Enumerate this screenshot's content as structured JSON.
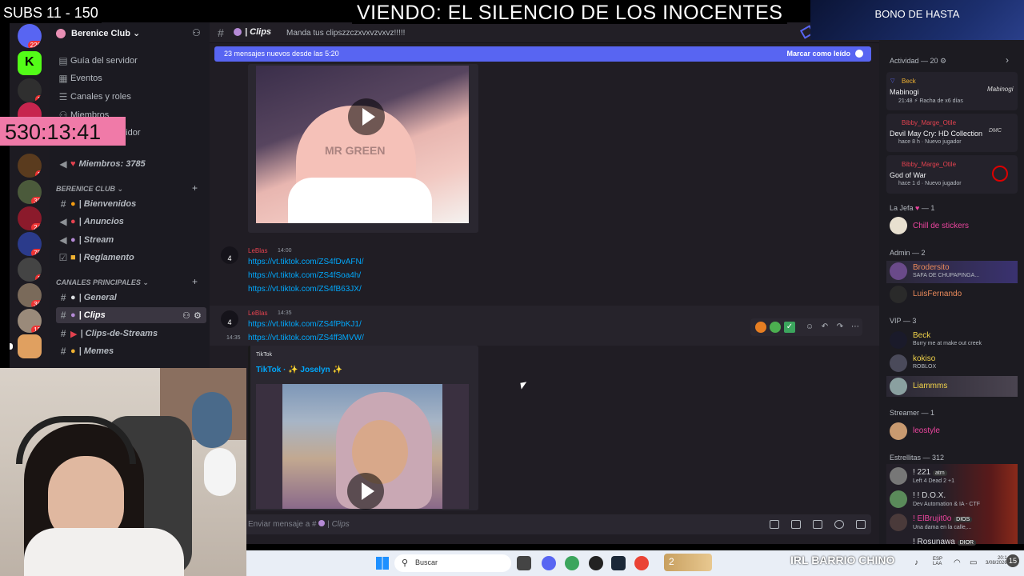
{
  "overlay": {
    "subs": "SUBS 11 - 150",
    "now_viewing": "VIENDO:  EL SILENCIO DE LOS INOCENTES",
    "bonus": "BONO DE HASTA",
    "timer": "530:13:41",
    "irl": "IRL BARRIO CHINO"
  },
  "rail": {
    "badges": [
      "226",
      "1",
      "1",
      "1",
      "38",
      "24",
      "75",
      "1",
      "36",
      "12"
    ]
  },
  "server": {
    "name": "Berenice Club",
    "top_items": [
      {
        "label": "Guía del servidor",
        "icon": "guide-icon"
      },
      {
        "label": "Eventos",
        "icon": "calendar-icon"
      },
      {
        "label": "Canales y roles",
        "icon": "list-icon"
      },
      {
        "label": "Miembros",
        "icon": "members-icon"
      },
      {
        "label": "rvidor",
        "icon": "server-icon"
      }
    ],
    "members_channel": "Miembros: 3785",
    "categories": [
      {
        "name": "BERENICE CLUB",
        "channels": [
          "Bienvenidos",
          "Anuncios",
          "Stream",
          "Reglamento"
        ]
      },
      {
        "name": "CANALES PRINCIPALES",
        "channels": [
          "General",
          "Clips",
          "Clips-de-Streams",
          "Memes"
        ]
      }
    ]
  },
  "channel": {
    "name": "Clips",
    "topic": "Manda tus clipszzczxvxvzvxvz!!!!!",
    "new_messages": "23 mensajes nuevos desde las 5:20",
    "mark_read": "Marcar como leído",
    "composer_placeholder": "Enviar mensaje a #",
    "composer_channel": "Clips"
  },
  "messages": [
    {
      "avatar_badge": "4",
      "author": "LeBlas",
      "time": "14:00",
      "links": [
        "https://vt.tiktok.com/ZS4fDvAFN/",
        "https://vt.tiktok.com/ZS4fSoa4h/",
        "https://vt.tiktok.com/ZS4fB63JX/"
      ]
    },
    {
      "avatar_badge": "4",
      "author": "LeBlas",
      "time": "14:35",
      "side_time": "14:35",
      "links": [
        "https://vt.tiktok.com/ZS4fPbKJ1/",
        "https://vt.tiktok.com/ZS4ff3MVW/"
      ]
    }
  ],
  "embed": {
    "provider": "TikTok",
    "title": "TikTok · ✨ Joselyn ✨",
    "watermark": "MR GREEN"
  },
  "members": {
    "activity_header": "Actividad — 20",
    "activities": [
      {
        "user": "Beck",
        "game": "Mabinogi",
        "meta": "21:48",
        "extra": "Racha de x6 días",
        "user_color": "#f0b232"
      },
      {
        "user": "Bibby_Marge_Otile",
        "game": "Devil May Cry: HD Collection",
        "meta": "hace 8 h",
        "extra": "Nuevo jugador",
        "user_color": "#e3424f"
      },
      {
        "user": "Bibby_Marge_Otile",
        "game": "God of War",
        "meta": "hace 1 d",
        "extra": "Nuevo jugador",
        "user_color": "#e3424f"
      }
    ],
    "groups": [
      {
        "title": "La Jefa",
        "count": "— 1",
        "members": [
          {
            "name": "Chill de stickers",
            "status": "",
            "color": "#eb459e"
          }
        ]
      },
      {
        "title": "Admin",
        "count": "— 2",
        "members": [
          {
            "name": "Brodersito",
            "status": "SAFA OE CHUPAPINGA...",
            "color": "#ea8a5b"
          },
          {
            "name": "LuisFernando",
            "status": "",
            "color": "#ea8a5b"
          }
        ]
      },
      {
        "title": "VIP",
        "count": "— 3",
        "members": [
          {
            "name": "Beck",
            "status": "Burry me at make out creek",
            "color": "#f0d24a"
          },
          {
            "name": "kokiso",
            "status": "ROBLOX",
            "color": "#f0d24a"
          },
          {
            "name": "Liammms",
            "status": "",
            "color": "#f0d24a"
          }
        ]
      },
      {
        "title": "Streamer",
        "count": "— 1",
        "members": [
          {
            "name": "leostyle",
            "status": "",
            "color": "#eb459e"
          }
        ]
      },
      {
        "title": "Estrellitas",
        "count": "— 312",
        "members": [
          {
            "name": "! 221",
            "status": "Left 4 Dead 2 +1",
            "color": "#dbdee1",
            "tag": "atm"
          },
          {
            "name": "! ! D.O.X.",
            "status": "Dev Automation & IA - CTF",
            "color": "#dbdee1",
            "tag": ""
          },
          {
            "name": "! ElBrujit0o",
            "status": "Una dama en la calle,...",
            "color": "#eb459e",
            "tag": "DIOS"
          },
          {
            "name": "! Rosunawa",
            "status": "",
            "color": "#dbdee1",
            "tag": "DIOR"
          }
        ]
      }
    ]
  },
  "taskbar": {
    "search": "Buscar",
    "counter": "2",
    "lang_top": "ESP",
    "lang_bottom": "LAA",
    "time": "20:1",
    "date": "3/08/2026"
  },
  "colors": {
    "accent": "#5865f2",
    "link": "#00a8fc",
    "timer_bg": "#f07aa8",
    "sidebar_bg": "#1b1a21",
    "chat_bg": "#201d24"
  }
}
